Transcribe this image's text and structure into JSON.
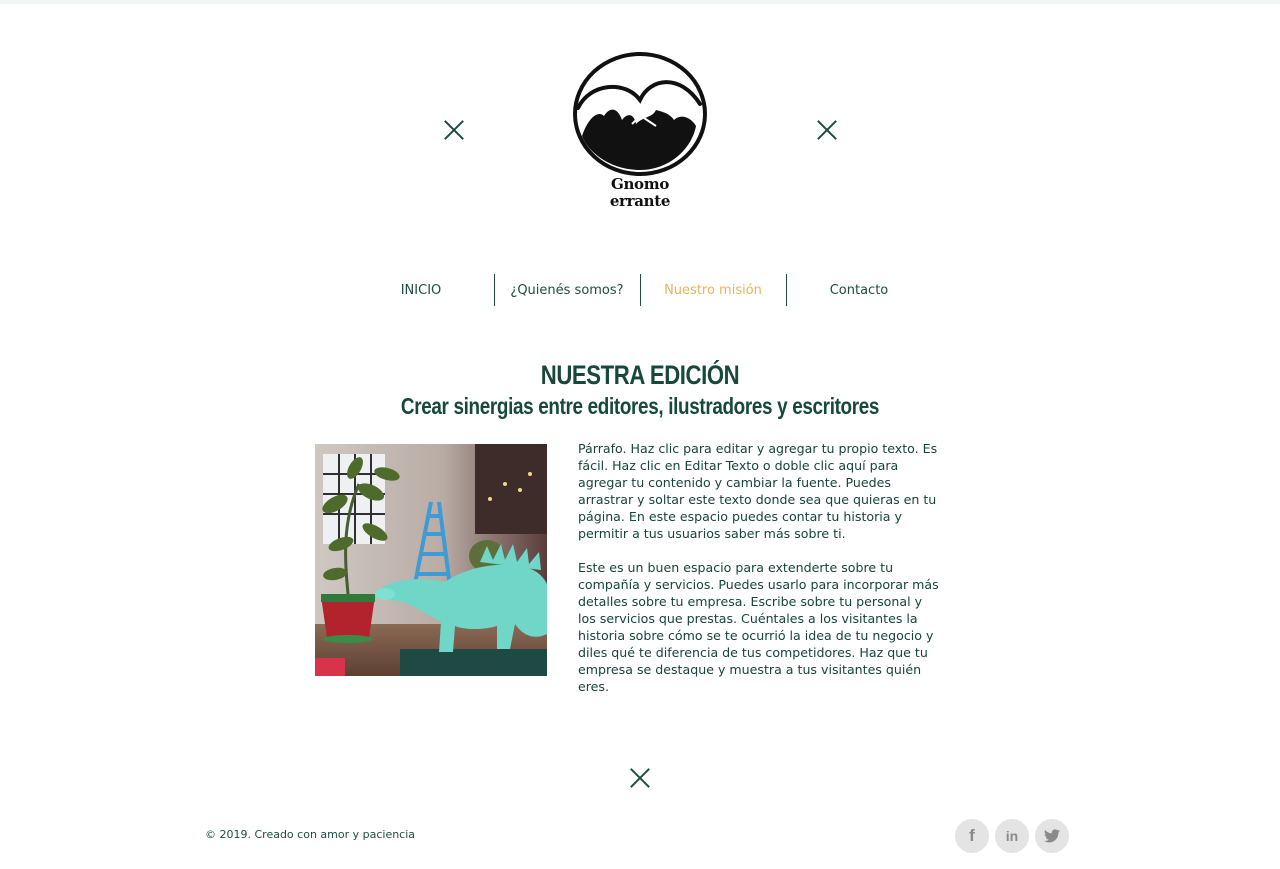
{
  "brand": {
    "name_line1": "Gnomo",
    "name_line2": "errante"
  },
  "nav": {
    "items": [
      {
        "label": "INICIO"
      },
      {
        "label": "¿Quienés somos?"
      },
      {
        "label": "Nuestro misión"
      },
      {
        "label": "Contacto"
      }
    ],
    "active_index": 2
  },
  "section": {
    "title": "NUESTRA EDICIÓN",
    "subtitle": "Crear sinergias entre editores, ilustradores y escritores"
  },
  "content": {
    "paragraph1": "Párrafo. Haz clic para editar y agregar tu propio texto. Es fácil. Haz clic en Editar Texto o doble clic aquí para agregar tu contenido y cambiar la fuente. Puedes arrastrar y soltar este texto donde sea que quieras en tu página. En este espacio puedes contar tu historia y permitir a tus usuarios saber más sobre ti.",
    "paragraph2": "Este es un buen espacio para extenderte sobre tu compañía y servicios. Puedes usarlo para incorporar más detalles sobre tu empresa. Escribe sobre tu personal y los servicios que prestas. Cuéntales a los visitantes la historia sobre cómo se te ocurrió la idea de tu negocio y diles qué te diferencia de tus competidores. Haz que tu empresa se destaque y muestra a tus visitantes quién eres."
  },
  "footer": {
    "copyright": "© 2019. Creado con amor y paciencia",
    "social": [
      {
        "icon": "facebook-icon",
        "glyph": "f"
      },
      {
        "icon": "linkedin-icon",
        "glyph": "in"
      },
      {
        "icon": "twitter-icon",
        "glyph": "t"
      }
    ]
  },
  "colors": {
    "accent_green": "#1d4d40",
    "active_orange": "#e9b35c"
  }
}
